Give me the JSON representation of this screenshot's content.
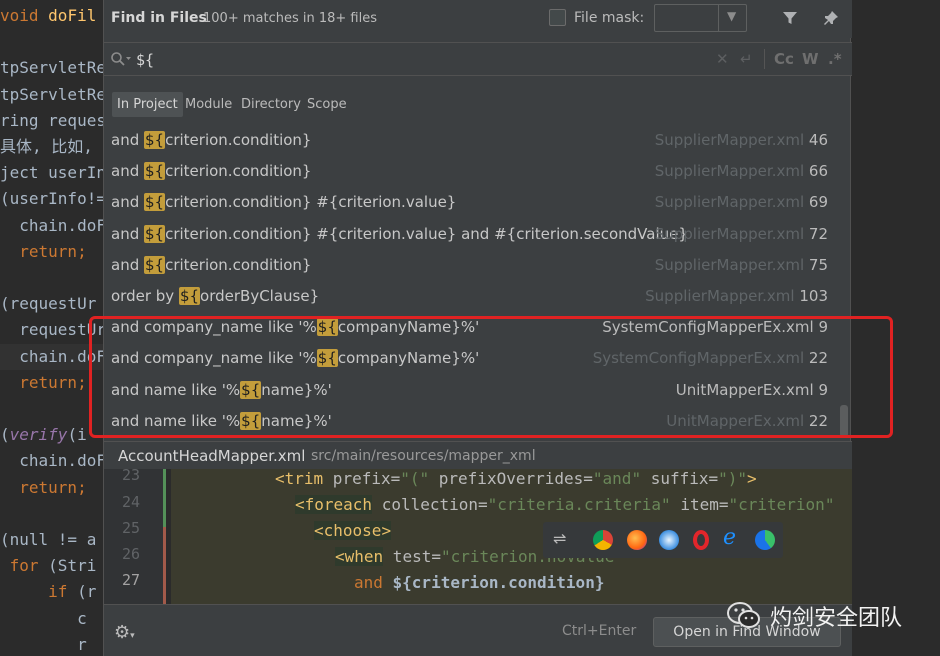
{
  "background_editor": {
    "lines": [
      {
        "pre": "",
        "kw": "void ",
        "fn": "doFil",
        "rest": ""
      },
      {
        "pre": "",
        "kw": "",
        "fn": "",
        "rest": ""
      },
      {
        "pre": "tpServletRe",
        "kw": "",
        "fn": "",
        "rest": ""
      },
      {
        "pre": "tpServletRe",
        "kw": "",
        "fn": "",
        "rest": ""
      },
      {
        "pre": "ring reques",
        "kw": "",
        "fn": "",
        "rest": ""
      },
      {
        "pre": "具体, 比如, 处",
        "kw": "",
        "fn": "",
        "rest": ""
      },
      {
        "pre": "ject userIn",
        "kw": "",
        "fn": "",
        "rest": ""
      },
      {
        "pre": "(userInfo!=",
        "kw": "",
        "fn": "",
        "rest": ""
      },
      {
        "pre": "  chain.doF",
        "kw": "",
        "fn": "",
        "rest": ""
      },
      {
        "pre": "  ",
        "kw": "return;",
        "fn": "",
        "rest": ""
      },
      {
        "pre": "",
        "kw": "",
        "fn": "",
        "rest": ""
      },
      {
        "pre": "(requestUr",
        "kw": "",
        "fn": "",
        "rest": ""
      },
      {
        "pre": "  requestUr",
        "kw": "",
        "fn": "",
        "rest": ""
      },
      {
        "pre": "  chain.doF",
        "kw": "",
        "fn": "",
        "rest": ""
      },
      {
        "pre": "  ",
        "kw": "return;",
        "fn": "",
        "rest": ""
      },
      {
        "pre": "",
        "kw": "",
        "fn": "",
        "rest": ""
      },
      {
        "pre": "(",
        "kw": "",
        "fn": "verify",
        "rest": "(i"
      },
      {
        "pre": "  chain.doF",
        "kw": "",
        "fn": "",
        "rest": ""
      },
      {
        "pre": "  ",
        "kw": "return;",
        "fn": "",
        "rest": ""
      },
      {
        "pre": "",
        "kw": "",
        "fn": "",
        "rest": ""
      },
      {
        "pre": "(null != a",
        "kw": "",
        "fn": "",
        "rest": ""
      },
      {
        "pre": " ",
        "kw": "for ",
        "fn": "",
        "rest": "(Stri"
      },
      {
        "pre": "     ",
        "kw": "if ",
        "fn": "",
        "rest": "(r"
      },
      {
        "pre": "        c",
        "kw": "",
        "fn": "",
        "rest": ""
      },
      {
        "pre": "        r",
        "kw": "",
        "fn": "",
        "rest": ""
      }
    ]
  },
  "find": {
    "title": "Find in Files",
    "match_count": "100+ matches in 18+ files",
    "file_mask_label": "File mask:",
    "file_mask_value": "",
    "query": "${",
    "search_buttons": {
      "case": "Cc",
      "words": "W",
      "regex": ".*"
    },
    "scopes": [
      {
        "label": "In Project",
        "active": true
      },
      {
        "label": "Module",
        "active": false
      },
      {
        "label": "Directory",
        "active": false
      },
      {
        "label": "Scope",
        "active": false
      }
    ],
    "results": [
      {
        "before": "and ",
        "match": "${",
        "after": "criterion.condition}",
        "file": "SupplierMapper.xml",
        "line": "46",
        "highlighted_file": false
      },
      {
        "before": "and ",
        "match": "${",
        "after": "criterion.condition}",
        "file": "SupplierMapper.xml",
        "line": "66",
        "highlighted_file": false
      },
      {
        "before": "and ",
        "match": "${",
        "after": "criterion.condition} #{criterion.value}",
        "file": "SupplierMapper.xml",
        "line": "69",
        "highlighted_file": false
      },
      {
        "before": "and ",
        "match": "${",
        "after": "criterion.condition} #{criterion.value} and #{criterion.secondValue}",
        "file": "SupplierMapper.xml",
        "line": "72",
        "highlighted_file": false
      },
      {
        "before": "and ",
        "match": "${",
        "after": "criterion.condition}",
        "file": "SupplierMapper.xml",
        "line": "75",
        "highlighted_file": false
      },
      {
        "before": "order by ",
        "match": "${",
        "after": "orderByClause}",
        "file": "SupplierMapper.xml",
        "line": "103",
        "highlighted_file": false
      },
      {
        "before": "and company_name like '%",
        "match": "${",
        "after": "companyName}%'",
        "file": "SystemConfigMapperEx.xml",
        "line": "9",
        "highlighted_file": true
      },
      {
        "before": "and company_name like '%",
        "match": "${",
        "after": "companyName}%'",
        "file": "SystemConfigMapperEx.xml",
        "line": "22",
        "highlighted_file": false
      },
      {
        "before": "and name like '%",
        "match": "${",
        "after": "name}%'",
        "file": "UnitMapperEx.xml",
        "line": "9",
        "highlighted_file": true
      },
      {
        "before": "and name like '%",
        "match": "${",
        "after": "name}%'",
        "file": "UnitMapperEx.xml",
        "line": "22",
        "highlighted_file": false
      }
    ],
    "preview": {
      "file": "AccountHeadMapper.xml",
      "path": "src/main/resources/mapper_xml",
      "lines": [
        {
          "num": "23",
          "current": false
        },
        {
          "num": "24",
          "current": false
        },
        {
          "num": "25",
          "current": false
        },
        {
          "num": "26",
          "current": false
        },
        {
          "num": "27",
          "current": true
        }
      ],
      "code": {
        "l23": {
          "tag": "<trim",
          "a1": " prefix=",
          "v1": "\"(\"",
          "a2": " prefixOverrides=",
          "v2": "\"and\"",
          "a3": " suffix=",
          "v3": "\")\"",
          "end": ">"
        },
        "l24": {
          "tag": "<foreach",
          "a1": " collection=",
          "v1": "\"criteria.criteria\"",
          "a2": " item=",
          "v2": "\"criterion\""
        },
        "l25": {
          "tag": "<choose",
          "end": ">"
        },
        "l26": {
          "tag": "<when",
          "a1": " test=",
          "v1": "\"criterion.noValue\""
        },
        "l27": {
          "kw": "and ",
          "text": "${criterion.condition}"
        }
      }
    },
    "footer": {
      "shortcut": "Ctrl+Enter",
      "open_button": "Open in Find Window"
    }
  },
  "watermark": {
    "text": "灼剑安全团队"
  },
  "colors": {
    "highlight": "#c39d3b",
    "annotation_box": "#e02222",
    "accent_keyword": "#cc7832"
  }
}
